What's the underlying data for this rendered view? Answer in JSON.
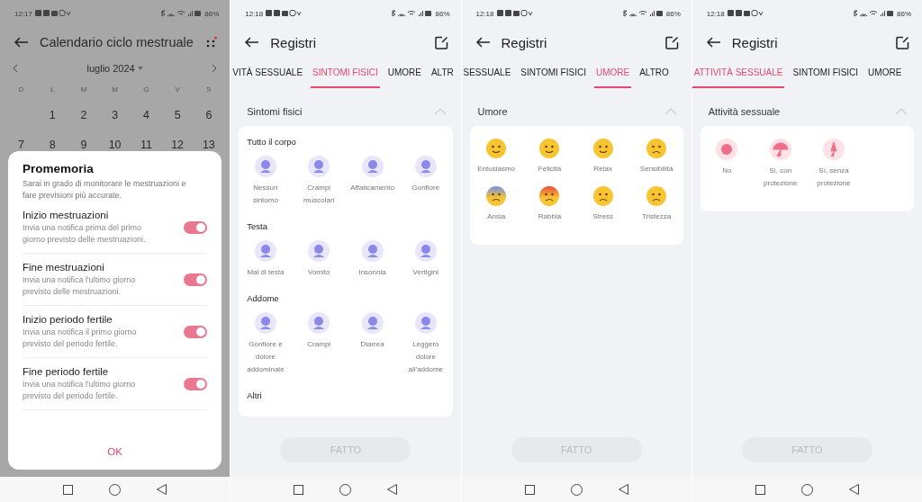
{
  "screens": [
    {
      "kind": "calendar",
      "status_bar": {
        "time": "12:17",
        "battery": "86%"
      },
      "title": "Calendario ciclo mestruale",
      "month": "luglio 2024",
      "weekdays": [
        "D",
        "L",
        "M",
        "M",
        "G",
        "V",
        "S"
      ],
      "weeks": [
        [
          "1",
          "2",
          "3",
          "4",
          "5",
          "6"
        ],
        [
          "7",
          "8",
          "9",
          "10",
          "11",
          "12",
          "13"
        ]
      ],
      "dialog": {
        "title": "Promemoria",
        "description": "Sarai in grado di monitorare le mestruazioni e fare previsioni più accurate.",
        "items": [
          {
            "title": "Inizio mestruazioni",
            "description": "Invia una notifica prima del primo giorno previsto delle mestruazioni.",
            "on": true
          },
          {
            "title": "Fine mestruazioni",
            "description": "Invia una notifica l'ultimo giorno previsto delle mestruazioni.",
            "on": true
          },
          {
            "title": "Inizio periodo fertile",
            "description": "Invia una notifica il primo giorno previsto del periodo fertile.",
            "on": true
          },
          {
            "title": "Fine periodo fertile",
            "description": "Invia una notifica l'ultimo giorno previsto del periodo fertile.",
            "on": true
          }
        ],
        "button": "OK"
      }
    },
    {
      "kind": "log",
      "status_bar": {
        "time": "12:18",
        "battery": "86%"
      },
      "title": "Registri",
      "tabs": [
        {
          "label": "VITÀ SESSUALE",
          "selected": false
        },
        {
          "label": "SINTOMI FISICI",
          "selected": true
        },
        {
          "label": "UMORE",
          "selected": false
        },
        {
          "label": "ALTR",
          "selected": false
        }
      ],
      "section": {
        "kind": "symptom",
        "title": "Sintomi fisici",
        "groups": [
          {
            "heading": "Tutto il corpo",
            "items": [
              "Nessun sintomo",
              "Crampi muscolari",
              "Affaticamento",
              "Gonfiore"
            ]
          },
          {
            "heading": "Testa",
            "items": [
              "Mal di testa",
              "Vomito",
              "Insonnia",
              "Vertigini"
            ]
          },
          {
            "heading": "Addome",
            "items": [
              "Gonfiore e dolore addominale",
              "Crampi",
              "Diarrea",
              "Leggero dolore all'addome"
            ]
          },
          {
            "heading": "Altri"
          }
        ]
      },
      "done_button": {
        "label": "FATTO",
        "disabled": true
      }
    },
    {
      "kind": "log",
      "status_bar": {
        "time": "12:18",
        "battery": "86%"
      },
      "title": "Registri",
      "tabs": [
        {
          "label": "SESSUALE",
          "selected": false
        },
        {
          "label": "SINTOMI FISICI",
          "selected": false
        },
        {
          "label": "UMORE",
          "selected": true
        },
        {
          "label": "ALTRO",
          "selected": false
        }
      ],
      "section": {
        "kind": "mood",
        "title": "Umore",
        "groups": [
          {
            "items": [
              "Entusiasmo",
              "Felicità",
              "Relax",
              "Sensibilità",
              "Ansia",
              "Rabbia",
              "Stress",
              "Tristezza"
            ]
          }
        ]
      },
      "done_button": {
        "label": "FATTO",
        "disabled": true
      }
    },
    {
      "kind": "log",
      "status_bar": {
        "time": "12:18",
        "battery": "86%"
      },
      "title": "Registri",
      "tabs": [
        {
          "label": "ATTIVITÀ SESSUALE",
          "selected": true
        },
        {
          "label": "SINTOMI FISICI",
          "selected": false
        },
        {
          "label": "UMORE",
          "selected": false
        }
      ],
      "section": {
        "kind": "activity",
        "title": "Attività sessuale",
        "groups": [
          {
            "items": [
              "No",
              "Sì, con protezione",
              "Sì, senza protezione"
            ]
          }
        ]
      },
      "done_button": {
        "label": "FATTO",
        "disabled": true
      }
    }
  ]
}
